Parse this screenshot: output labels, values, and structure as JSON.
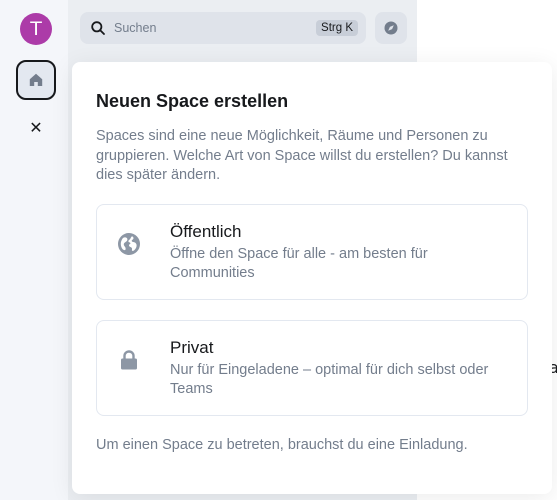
{
  "spacebar": {
    "avatar_initial": "T",
    "avatar_color": "#ac3ba8",
    "home_icon": "home-icon",
    "close_icon": "close-icon",
    "close_glyph": "✕"
  },
  "roomlist": {
    "search": {
      "icon": "search-icon",
      "placeholder": "Suchen",
      "shortcut": "Strg K"
    },
    "explore_icon": "compass-icon",
    "behind_glyph": "a"
  },
  "modal": {
    "title": "Neuen Space erstellen",
    "description": "Spaces sind eine neue Möglichkeit, Räume und Personen zu gruppieren. Welche Art von Space willst du erstellen? Du kannst dies später ändern.",
    "options": [
      {
        "icon": "globe-icon",
        "title": "Öffentlich",
        "description": "Öffne den Space für alle - am besten für Communities"
      },
      {
        "icon": "lock-icon",
        "title": "Privat",
        "description": "Nur für Eingeladene – optimal für dich selbst oder Teams"
      }
    ],
    "footer": "Um einen Space zu betreten, brauchst du eine Einladung."
  },
  "colors": {
    "primary_text": "#17191c",
    "secondary_text": "#737d8c",
    "icon": "#8d97a5",
    "border": "#e3e8f0"
  }
}
